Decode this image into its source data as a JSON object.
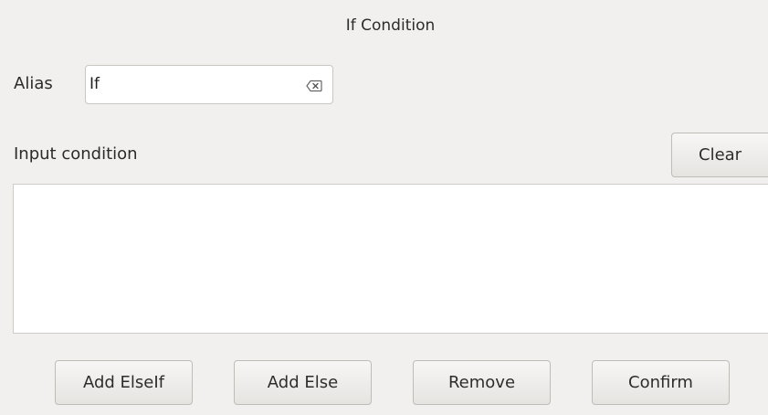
{
  "dialog": {
    "title": "If Condition"
  },
  "alias": {
    "label": "Alias",
    "value": "If"
  },
  "condition": {
    "label": "Input condition",
    "clear_label": "Clear",
    "value": ""
  },
  "footer": {
    "buttons": [
      {
        "label": "Add ElseIf"
      },
      {
        "label": "Add Else"
      },
      {
        "label": "Remove"
      },
      {
        "label": "Confirm"
      }
    ]
  },
  "icons": {
    "clear_field": "clear-text-icon"
  }
}
